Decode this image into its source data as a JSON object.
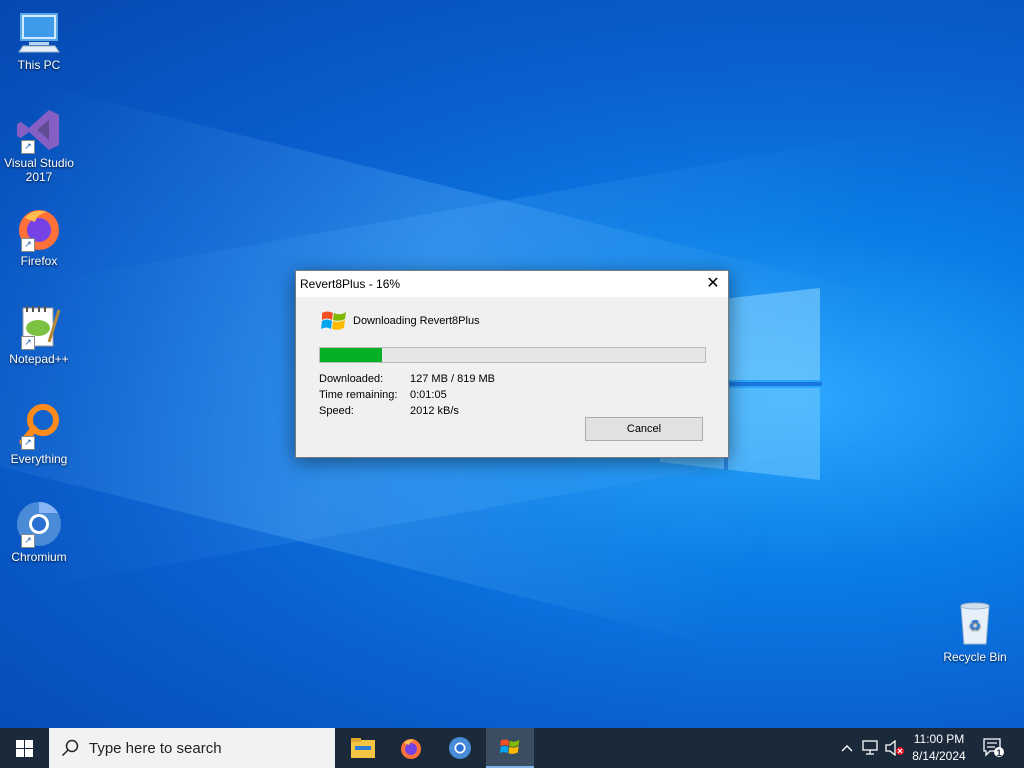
{
  "desktop": {
    "icons": [
      {
        "label": "This PC"
      },
      {
        "label": "Visual Studio 2017"
      },
      {
        "label": "Firefox"
      },
      {
        "label": "Notepad++"
      },
      {
        "label": "Everything"
      },
      {
        "label": "Chromium"
      },
      {
        "label": "Recycle Bin"
      }
    ]
  },
  "dialog": {
    "title": "Revert8Plus - 16%",
    "close_label": "✕",
    "heading": "Downloading Revert8Plus",
    "progress_percent": 16,
    "downloaded_label": "Downloaded:",
    "downloaded_value": "127 MB / 819 MB",
    "time_label": "Time remaining:",
    "time_value": "0:01:05",
    "speed_label": "Speed:",
    "speed_value": "2012 kB/s",
    "cancel_label": "Cancel"
  },
  "taskbar": {
    "search_placeholder": "Type here to search",
    "apps": [
      "file-explorer-icon",
      "firefox-icon",
      "chromium-icon",
      "revert8plus-icon"
    ],
    "time": "11:00 PM",
    "date": "8/14/2024",
    "notification_count": "1"
  },
  "colors": {
    "progress_fill": "#06b025",
    "taskbar_bg": "#1b2a3a",
    "desktop_blue": "#0a7de6"
  }
}
